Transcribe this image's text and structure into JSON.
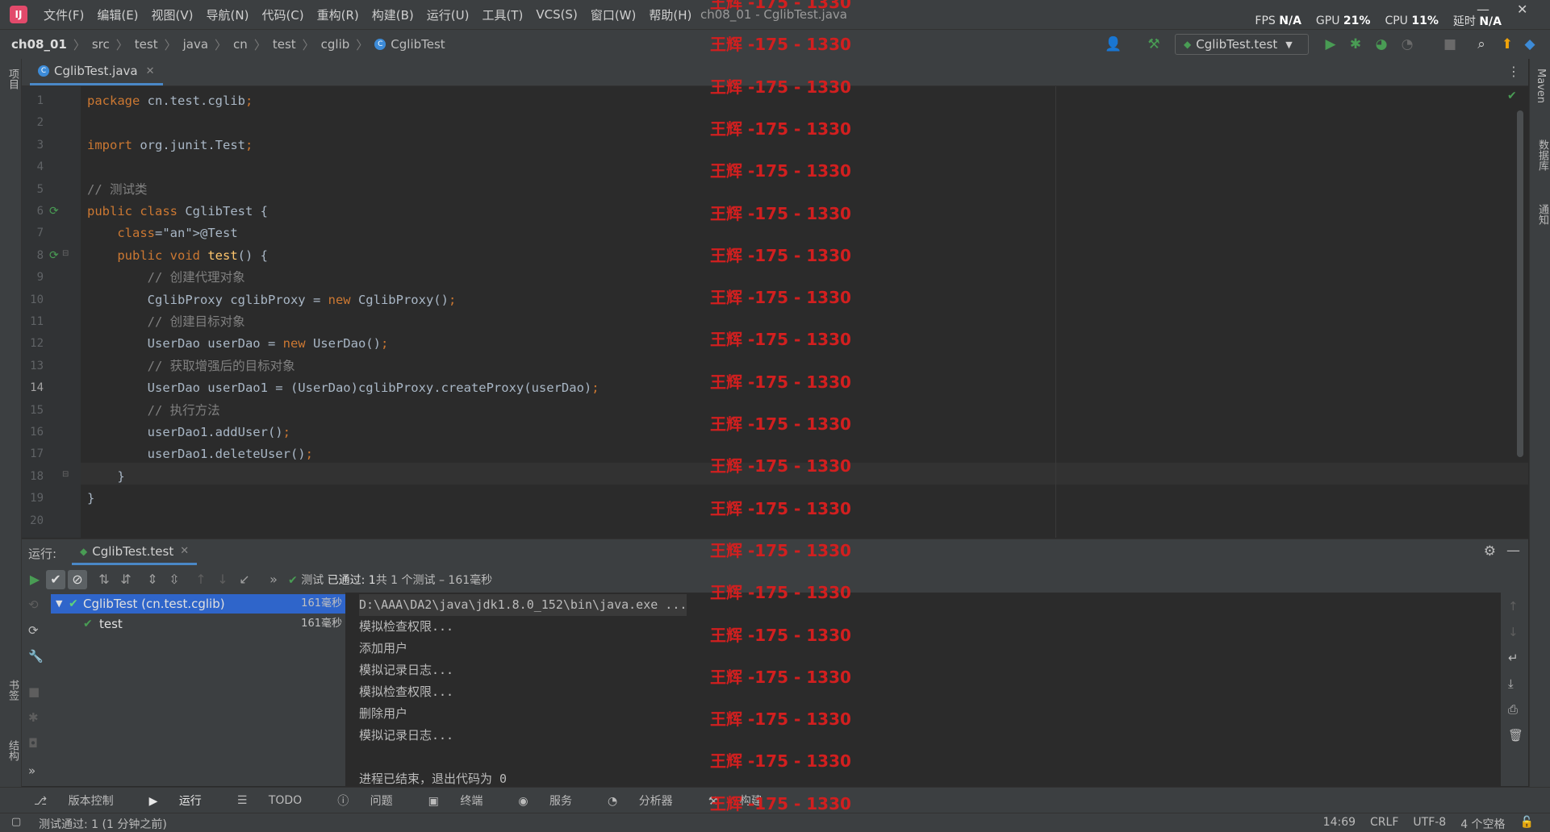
{
  "menubar": {
    "logo": "IJ",
    "menus": [
      "文件(F)",
      "编辑(E)",
      "视图(V)",
      "导航(N)",
      "代码(C)",
      "重构(R)",
      "构建(B)",
      "运行(U)",
      "工具(T)",
      "VCS(S)",
      "窗口(W)",
      "帮助(H)"
    ],
    "window_title": "ch08_01 - CglibTest.java",
    "perf": {
      "fps_label": "FPS",
      "fps_value": "N/A",
      "gpu_label": "GPU",
      "gpu_value": "21%",
      "cpu_label": "CPU",
      "cpu_value": "11%",
      "latency_label": "延时",
      "latency_value": "N/A"
    }
  },
  "breadcrumbs": [
    "ch08_01",
    "src",
    "test",
    "java",
    "cn",
    "test",
    "cglib",
    "CglibTest"
  ],
  "run_config": "CglibTest.test",
  "editor_tab": {
    "label": "CglibTest.java"
  },
  "left_stripe": {
    "project": "项目",
    "bookmarks": "书签",
    "structure": "结构"
  },
  "right_stripe": {
    "maven": "Maven",
    "database": "数据库",
    "notifications": "通知"
  },
  "code_lines": [
    "package cn.test.cglib;",
    "",
    "import org.junit.Test;",
    "",
    "// 测试类",
    "public class CglibTest {",
    "    @Test",
    "    public void test() {",
    "        // 创建代理对象",
    "        CglibProxy cglibProxy = new CglibProxy();",
    "        // 创建目标对象",
    "        UserDao userDao = new UserDao();",
    "        // 获取增强后的目标对象",
    "        UserDao userDao1 = (UserDao)cglibProxy.createProxy(userDao);",
    "        // 执行方法",
    "        userDao1.addUser();",
    "        userDao1.deleteUser();",
    "    }",
    "}",
    ""
  ],
  "line_numbers": [
    "1",
    "2",
    "3",
    "4",
    "5",
    "6",
    "7",
    "8",
    "9",
    "10",
    "11",
    "12",
    "13",
    "14",
    "15",
    "16",
    "17",
    "18",
    "19",
    "20"
  ],
  "run_panel": {
    "label": "运行:",
    "tab": "CglibTest.test",
    "status_prefix": "测试",
    "status_passed": "已通过: 1",
    "status_detail": "共 1 个测试 – 161毫秒",
    "tree": [
      {
        "name": "CglibTest (cn.test.cglib)",
        "time": "161毫秒"
      },
      {
        "name": "test",
        "time": "161毫秒"
      }
    ],
    "console": [
      "D:\\AAA\\DA2\\java\\jdk1.8.0_152\\bin\\java.exe ...",
      "模拟检查权限...",
      "添加用户",
      "模拟记录日志...",
      "模拟检查权限...",
      "删除用户",
      "模拟记录日志...",
      "",
      "进程已结束，退出代码为 0"
    ]
  },
  "bottom_tabs": [
    "版本控制",
    "运行",
    "TODO",
    "问题",
    "终端",
    "服务",
    "分析器",
    "构建"
  ],
  "status_bar": {
    "message": "测试通过: 1 (1 分钟之前)",
    "position": "14:69",
    "line_sep": "CRLF",
    "encoding": "UTF-8",
    "indent": "4 个空格"
  },
  "watermark": "王辉 -175 - 1330",
  "colors": {
    "accent": "#4a88c7",
    "selection": "#2f65ca",
    "keyword": "#cc7832",
    "comment": "#808080",
    "annotation": "#bbb529",
    "method": "#ffc66d",
    "pass_green": "#499c54",
    "watermark": "#d21f1f"
  }
}
